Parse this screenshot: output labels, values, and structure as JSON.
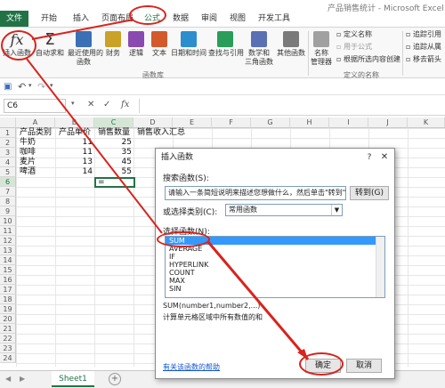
{
  "window": {
    "title": "产品销售统计 - Microsoft Excel"
  },
  "tabs": [
    {
      "label": "文件"
    },
    {
      "label": "开始"
    },
    {
      "label": "插入"
    },
    {
      "label": "页面布局"
    },
    {
      "label": "公式"
    },
    {
      "label": "数据"
    },
    {
      "label": "审阅"
    },
    {
      "label": "视图"
    },
    {
      "label": "开发工具"
    }
  ],
  "ribbon": {
    "insert_function": {
      "line1": "插入函数"
    },
    "autosum": {
      "line1": "自动求和"
    },
    "recent": {
      "line1": "最近使用的",
      "line2": "函数"
    },
    "financial": {
      "line1": "财务"
    },
    "logical": {
      "line1": "逻辑"
    },
    "text": {
      "line1": "文本"
    },
    "datetime": {
      "line1": "日期和时间"
    },
    "lookup": {
      "line1": "查找与引用"
    },
    "math": {
      "line1": "数学和",
      "line2": "三角函数"
    },
    "more": {
      "line1": "其他函数"
    },
    "group_library": "函数库",
    "name_manager": {
      "line1": "名称",
      "line2": "管理器"
    },
    "define_name": "定义名称",
    "use_in_formula": "用于公式",
    "create_from_selection": "根据所选内容创建",
    "group_defined_names": "定义的名称",
    "trace_precedents": "追踪引用",
    "trace_dependents": "追踪从属",
    "remove_arrows": "移去箭头"
  },
  "formula_bar": {
    "name_box": "C6",
    "fx": "fx"
  },
  "columns": [
    "A",
    "B",
    "C",
    "D",
    "E",
    "F",
    "G",
    "H",
    "I",
    "J",
    "K"
  ],
  "rows": [
    "1",
    "2",
    "3",
    "4",
    "5",
    "6",
    "7",
    "8",
    "9",
    "10",
    "11",
    "12",
    "13",
    "14",
    "15",
    "16",
    "17",
    "18",
    "19",
    "20",
    "21",
    "22",
    "23",
    "24"
  ],
  "sheet": {
    "headers": [
      "产品类别",
      "产品单价",
      "销售数量",
      "销售收入汇总"
    ],
    "data": [
      [
        "牛奶",
        "11",
        "25"
      ],
      [
        "咖啡",
        "11",
        "35"
      ],
      [
        "麦片",
        "13",
        "45"
      ],
      [
        "啤酒",
        "14",
        "55"
      ]
    ],
    "active_cell_value": "="
  },
  "sheet_tabs": {
    "active": "Sheet1",
    "add": "+"
  },
  "dialog": {
    "title": "插入函数",
    "help": "?",
    "close": "✕",
    "search_label": "搜索函数(S):",
    "search_value": "请输入一条简短说明来描述您想做什么，然后单击\"转到\"",
    "go_button": "转到(G)",
    "category_label": "或选择类别(C):",
    "category_value": "常用函数",
    "select_label": "选择函数(N):",
    "functions": [
      "SUM",
      "AVERAGE",
      "IF",
      "HYPERLINK",
      "COUNT",
      "MAX",
      "SIN"
    ],
    "selected_function": "SUM",
    "signature": "SUM(number1,number2,...)",
    "description": "计算单元格区域中所有数值的和",
    "help_link": "有关该函数的帮助",
    "ok_button": "确定",
    "cancel_button": "取消"
  }
}
